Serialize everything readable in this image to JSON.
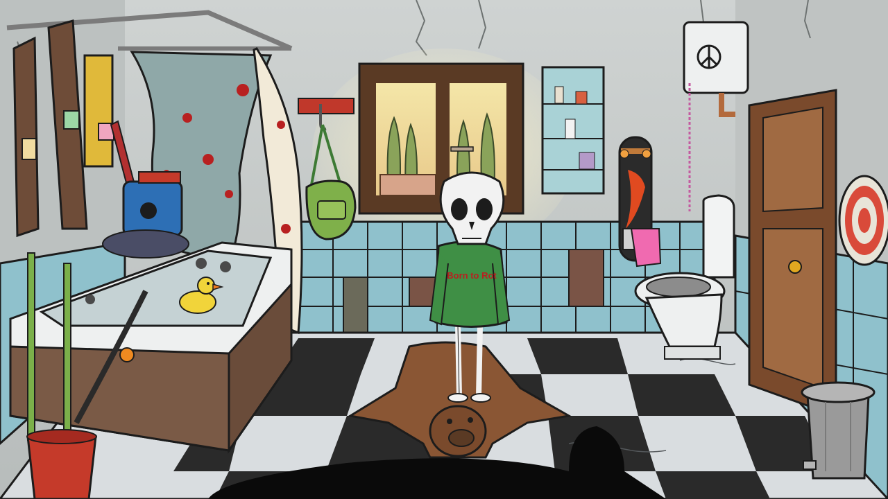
{
  "scene": {
    "room": "bathroom",
    "character": "skeleton",
    "hoodie_text": "Born to Rot",
    "tank_symbol": "peace-sign"
  },
  "colors": {
    "wall": "#c9cccb",
    "tile_blue": "#8fc1cc",
    "tile_dark": "#2a2a2a",
    "tile_light": "#d9dde0",
    "wood": "#6b4a33",
    "hoodie": "#3f8f45",
    "rug": "#8a5634",
    "duck": "#f1d43a",
    "chainsaw": "#2d6fb5",
    "door": "#7a4a2c"
  },
  "icons": [
    "peace-sign-icon",
    "rubber-duck-icon",
    "target-icon",
    "skateboard-icon"
  ]
}
